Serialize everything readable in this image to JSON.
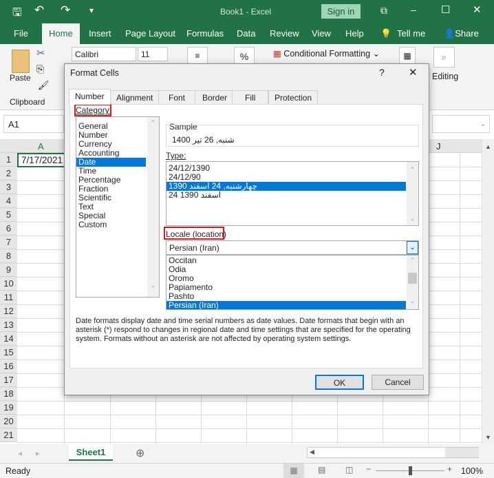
{
  "app": {
    "title": "Book1  -  Excel",
    "sign_in": "Sign in"
  },
  "ribbon_tabs": [
    "File",
    "Home",
    "Insert",
    "Page Layout",
    "Formulas",
    "Data",
    "Review",
    "View",
    "Help",
    "Tell me",
    "Share"
  ],
  "ribbon": {
    "paste": "Paste",
    "clipboard": "Clipboard",
    "font_name": "Calibri",
    "font_size": "11",
    "percent": "%",
    "conditional_formatting": "Conditional Formatting",
    "editing": "Editing"
  },
  "formula_bar": {
    "name_box": "A1"
  },
  "grid": {
    "col_a": "A",
    "col_j": "J",
    "cell_a1": "7/17/2021",
    "rows": [
      "1",
      "2",
      "3",
      "4",
      "5",
      "6",
      "7",
      "8",
      "9",
      "10",
      "11",
      "12",
      "13",
      "14",
      "15",
      "16",
      "17",
      "18",
      "19",
      "20",
      "21"
    ]
  },
  "dialog": {
    "title": "Format Cells",
    "help": "?",
    "close": "✕",
    "tabs": [
      "Number",
      "Alignment",
      "Font",
      "Border",
      "Fill",
      "Protection"
    ],
    "category_label": "Category:",
    "categories": [
      "General",
      "Number",
      "Currency",
      "Accounting",
      "Date",
      "Time",
      "Percentage",
      "Fraction",
      "Scientific",
      "Text",
      "Special",
      "Custom"
    ],
    "selected_category": "Date",
    "sample_label": "Sample",
    "sample_value": "شنبه, 26 تیر 1400",
    "type_label": "Type:",
    "types": [
      "24/12/1390",
      "24/12/90",
      "چهارشنبه, 24 اسفند 1390",
      "24 اسفند 1390"
    ],
    "selected_type": "چهارشنبه, 24 اسفند 1390",
    "locale_label": "Locale (location)",
    "locale_value": "Persian (Iran)",
    "locales": [
      "Occitan",
      "Odia",
      "Oromo",
      "Papiamento",
      "Pashto",
      "Persian (Iran)"
    ],
    "description": "Date formats display date and time serial numbers as date values.  Date formats that begin with an asterisk (*) respond to changes in regional date and time settings that are specified for the operating system. Formats without an asterisk are not affected by operating system settings.",
    "ok": "OK",
    "cancel": "Cancel"
  },
  "sheet": {
    "tab": "Sheet1"
  },
  "status": {
    "ready": "Ready",
    "zoom": "100%",
    "zoom_fraction": 0.5
  },
  "colors": {
    "excel_green": "#217346",
    "selection": "#0078d7",
    "highlight_box": "#d71920"
  }
}
